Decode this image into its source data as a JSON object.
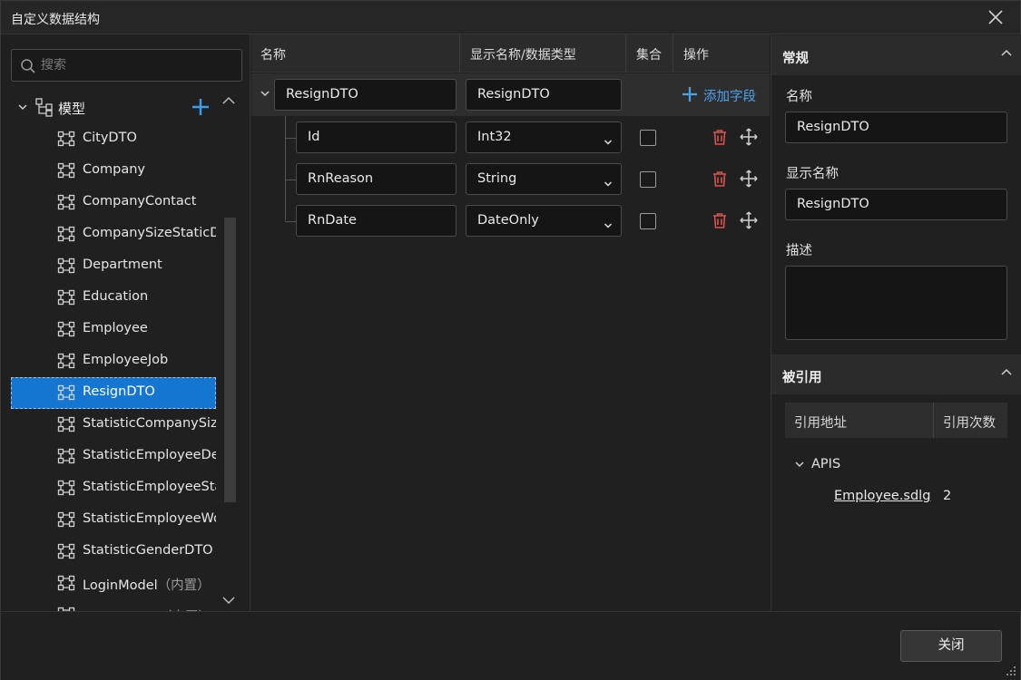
{
  "window": {
    "title": "自定义数据结构",
    "close_label": "关闭"
  },
  "left": {
    "search_placeholder": "搜索",
    "root_label": "模型",
    "items": [
      {
        "label": "CityDTO",
        "suffix": ""
      },
      {
        "label": "Company",
        "suffix": ""
      },
      {
        "label": "CompanyContact",
        "suffix": ""
      },
      {
        "label": "CompanySizeStaticDTO",
        "suffix": ""
      },
      {
        "label": "Department",
        "suffix": ""
      },
      {
        "label": "Education",
        "suffix": ""
      },
      {
        "label": "Employee",
        "suffix": ""
      },
      {
        "label": "EmployeeJob",
        "suffix": ""
      },
      {
        "label": "ResignDTO",
        "suffix": ""
      },
      {
        "label": "StatisticCompanySizeDTO",
        "suffix": ""
      },
      {
        "label": "StatisticEmployeeDegree",
        "suffix": ""
      },
      {
        "label": "StatisticEmployeeStatus",
        "suffix": ""
      },
      {
        "label": "StatisticEmployeeWork",
        "suffix": ""
      },
      {
        "label": "StatisticGenderDTO",
        "suffix": ""
      },
      {
        "label": "LoginModel",
        "suffix": "（内置）"
      },
      {
        "label": "LoginResult",
        "suffix": "（内置）"
      }
    ],
    "selected_index": 8
  },
  "center": {
    "headers": {
      "name": "名称",
      "display_type": "显示名称/数据类型",
      "collection": "集合",
      "actions": "操作"
    },
    "dto": {
      "name": "ResignDTO",
      "display_name": "ResignDTO",
      "add_field_label": "添加字段"
    },
    "fields": [
      {
        "name": "Id",
        "type": "Int32",
        "collection": false
      },
      {
        "name": "RnReason",
        "type": "String",
        "collection": false
      },
      {
        "name": "RnDate",
        "type": "DateOnly",
        "collection": false
      }
    ]
  },
  "right": {
    "general_title": "常规",
    "name_label": "名称",
    "name_value": "ResignDTO",
    "display_label": "显示名称",
    "display_value": "ResignDTO",
    "desc_label": "描述",
    "desc_value": "",
    "refs_title": "被引用",
    "ref_col_address": "引用地址",
    "ref_col_count": "引用次数",
    "ref_group": "APIS",
    "ref_file": "Employee.sdlg",
    "ref_count": "2"
  },
  "colors": {
    "accent": "#1476d0",
    "add_blue": "#4aa3ef",
    "trash_red": "#d9534f"
  }
}
